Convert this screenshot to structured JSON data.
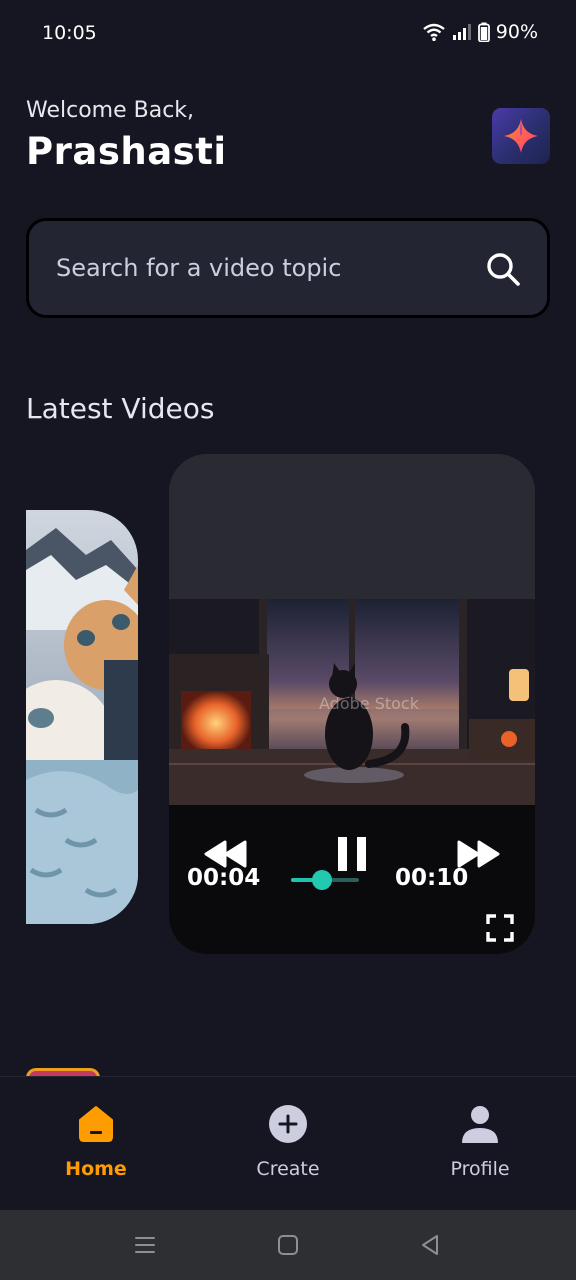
{
  "status_bar": {
    "time": "10:05",
    "battery_percent": "90%",
    "icons": [
      "wifi-icon",
      "signal-icon",
      "battery-icon"
    ]
  },
  "header": {
    "welcome_text": "Welcome Back,",
    "user_name": "Prashasti",
    "logo_icon": "app-logo-icon"
  },
  "search": {
    "placeholder": "Search for a video topic",
    "icon": "search-icon"
  },
  "latest_videos": {
    "title": "Latest Videos",
    "player": {
      "current_time": "00:04",
      "total_time": "00:10",
      "progress_fraction": 0.45,
      "watermark": "Adobe Stock"
    }
  },
  "bottom_nav": {
    "items": [
      {
        "label": "Home",
        "icon": "home-icon",
        "active": true
      },
      {
        "label": "Create",
        "icon": "plus-circle-icon",
        "active": false
      },
      {
        "label": "Profile",
        "icon": "user-icon",
        "active": false
      }
    ]
  },
  "colors": {
    "background": "#161622",
    "accent": "#FF9C01",
    "slider": "#22C9B0",
    "search_bg": "#232533"
  }
}
